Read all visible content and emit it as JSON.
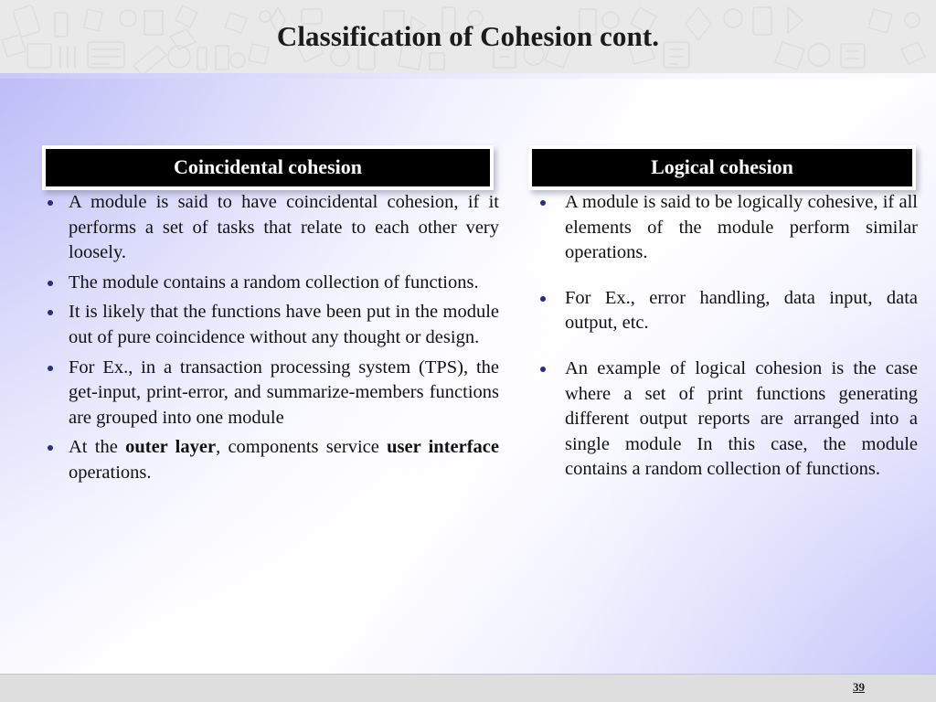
{
  "slide": {
    "title": "Classification of Cohesion cont.",
    "page_number": "39",
    "accent_color": "#2b2b86",
    "heading_box_bg": "#000000",
    "heading_box_text_color": "#ffffff",
    "background_tint": "#cdcdfa",
    "header_band_color": "#e9e9e9",
    "footer_band_color": "#dedede"
  },
  "left_column": {
    "heading": "Coincidental cohesion",
    "bullets": [
      {
        "parts": [
          {
            "text": "A module is said to have coincidental cohesion, if it performs a set of tasks that relate to each other very loosely.",
            "bold": false
          }
        ]
      },
      {
        "parts": [
          {
            "text": "The module contains a random collection of functions.",
            "bold": false
          }
        ]
      },
      {
        "parts": [
          {
            "text": "It is likely that the functions have been put in the module out of pure coincidence without any thought or design.",
            "bold": false
          }
        ]
      },
      {
        "parts": [
          {
            "text": "For Ex., in a transaction processing system (TPS), the get-input, print-error, and summarize-members functions are grouped into one module",
            "bold": false
          }
        ]
      },
      {
        "parts": [
          {
            "text": "At the ",
            "bold": false
          },
          {
            "text": "outer layer",
            "bold": true
          },
          {
            "text": ", components service ",
            "bold": false
          },
          {
            "text": "user interface",
            "bold": true
          },
          {
            "text": " operations.",
            "bold": false
          }
        ]
      }
    ]
  },
  "right_column": {
    "heading": "Logical cohesion",
    "bullets": [
      {
        "parts": [
          {
            "text": "A module is said to be logically cohesive, if all elements of the module perform similar operations.",
            "bold": false
          }
        ]
      },
      {
        "parts": [
          {
            "text": "For Ex., error handling, data input, data output, etc.",
            "bold": false
          }
        ]
      },
      {
        "parts": [
          {
            "text": "An example of logical cohesion is the case where a set of print functions generating different output reports are arranged into a single module In this case, the module contains a random collection of functions.",
            "bold": false
          }
        ]
      }
    ]
  }
}
